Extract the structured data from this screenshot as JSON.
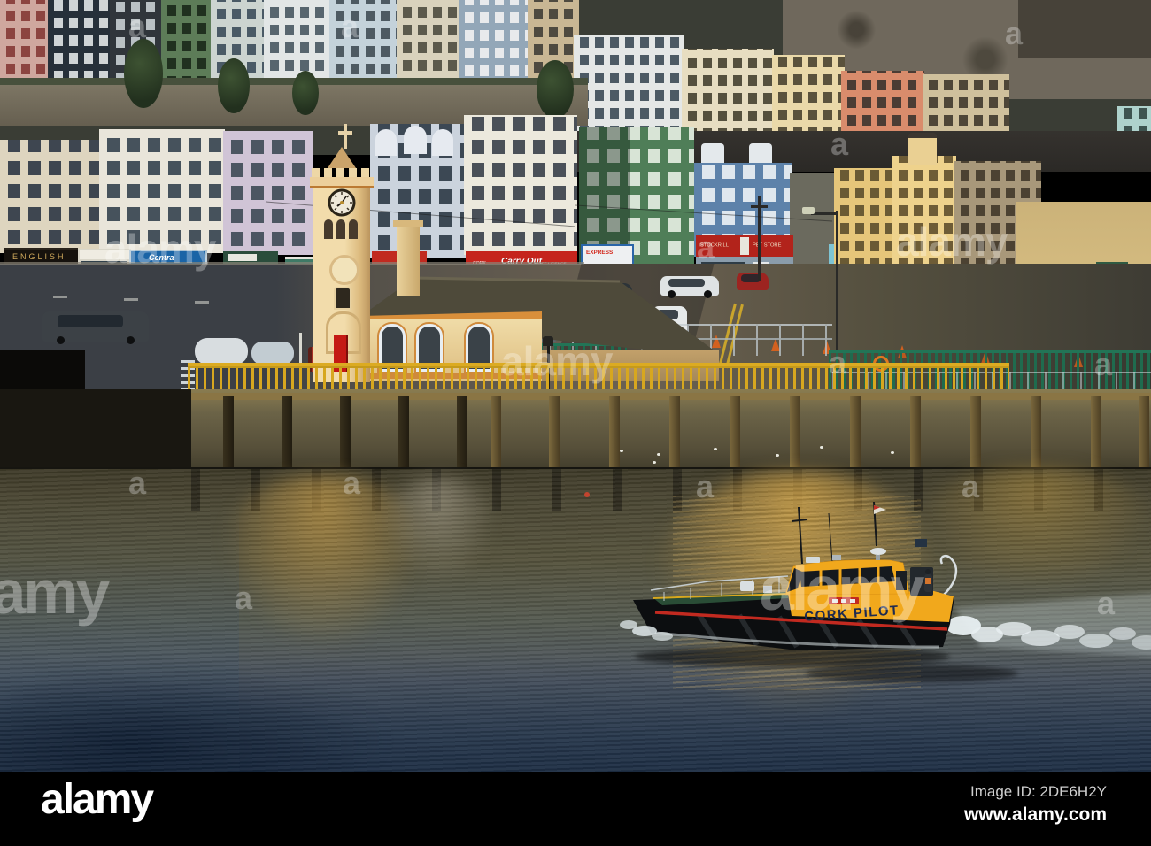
{
  "photo": {
    "description": "Yellow Cork Pilot boat crossing golden harbour water in front of the colourful terraced waterfront, clock tower and timber pier of Cobh, Ireland",
    "signs": {
      "english_shop": "ENGLISH",
      "centra_shop": "Centra",
      "carry_out": {
        "left": "CORK",
        "name": "Carry Out",
        "right": "OFF LICENCE"
      },
      "express_shop": "EXPRESS",
      "pet_store": {
        "left": "STOCKRILL",
        "right": "PET STORE"
      },
      "boat": "CORK PILOT"
    },
    "palette": {
      "boat_yellow": "#f1a81c",
      "boat_hull_black": "#0c0e10",
      "boat_stripe_red": "#c22a20",
      "railing_yellow": "#d7a71f",
      "fence_green": "#1f6b4e",
      "carry_out_red": "#c5241c",
      "pet_store_red": "#b2231b",
      "centra_blue": "#1a64a6",
      "green_building": "#4f7e58",
      "blue_building": "#5d82aa",
      "water_gold": "#c6a04a",
      "water_blue": "#2c3e54"
    }
  },
  "watermark": {
    "brand": "alamy",
    "letter": "a"
  },
  "footer": {
    "logo": "alamy",
    "image_id": "Image ID: 2DE6H2Y",
    "website": "www.alamy.com"
  }
}
